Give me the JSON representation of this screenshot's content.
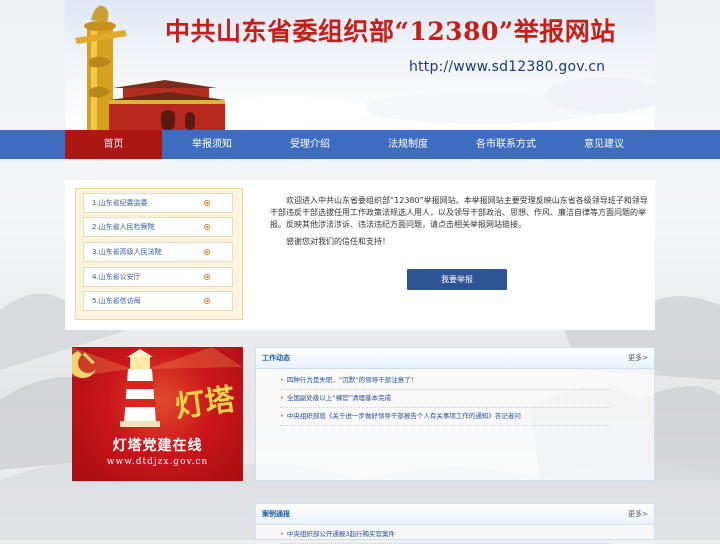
{
  "banner": {
    "title": "中共山东省委组织部“12380”举报网站",
    "url": "http://www.sd12380.gov.cn"
  },
  "nav": {
    "items": [
      "首页",
      "举报须知",
      "受理介绍",
      "法规制度",
      "各市联系方式",
      "意见建议"
    ],
    "active_index": 0
  },
  "links": [
    "1.山东省纪委监委",
    "2.山东省人民检察院",
    "3.山东省高级人民法院",
    "4.山东省公安厅",
    "5.山东省信访局"
  ],
  "intro": {
    "paragraph1": "欢迎进入中共山东省委组织部“12380”举报网站。本举报网站主要受理反映山东省各级领导班子和领导干部违反干部选拔任用工作政策法规选人用人，以及领导干部政治、思想、作风、廉洁自律等方面问题的举报。反映其他涉法涉诉、违法违纪方面问题，请点击相关举报网站链接。",
    "paragraph2": "感谢您对我们的信任和支持！",
    "report_button": "我要举报"
  },
  "lighthouse": {
    "characters": "灯塔",
    "title": "灯塔党建在线",
    "url": "www.dtdjzx.gov.cn"
  },
  "work_news": {
    "title": "工作动态",
    "more": "更多>",
    "items": [
      "四种行为是失职，“沉默”的领导干部注意了！",
      "全国副处级以上“裸官”清理基本完成",
      "中央组织部就《关于进一步做好领导干部报告个人有关事项工作的通知》答记者问"
    ]
  },
  "case_news": {
    "title": "案例通报",
    "more": "更多>",
    "items": [
      "中央组织部公开通报3起行贿买官案件"
    ]
  },
  "colors": {
    "nav_bg": "#3e6dc0",
    "nav_active": "#ad1713",
    "title_red": "#c81d17",
    "button_blue": "#2f5496",
    "link_blue": "#2f57a8"
  }
}
